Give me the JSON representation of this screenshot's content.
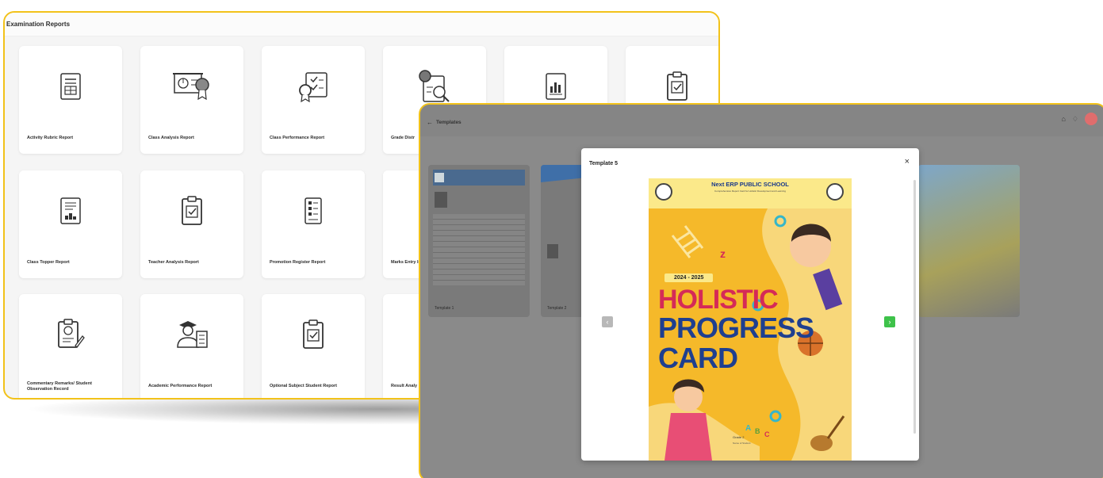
{
  "back_window": {
    "title": "Examination Reports",
    "reports": [
      {
        "label": "Activity Rubric Report",
        "icon": "report-sheet-icon"
      },
      {
        "label": "Class Analysis Report",
        "icon": "presentation-award-icon"
      },
      {
        "label": "Class Performance Report",
        "icon": "checklist-award-icon"
      },
      {
        "label": "Grade Distr",
        "icon": "document-search-icon"
      },
      {
        "label": "",
        "icon": "bar-chart-doc-icon"
      },
      {
        "label": "",
        "icon": "clipboard-check-icon"
      },
      {
        "label": "Class Topper Report",
        "icon": "ranking-doc-icon"
      },
      {
        "label": "Teacher Analysis Report",
        "icon": "clipboard-check-icon"
      },
      {
        "label": "Promotion Register Report",
        "icon": "list-doc-icon"
      },
      {
        "label": "Marks Entry Indicator R",
        "icon": "marks-entry-icon"
      },
      {
        "label": "Commentary Remarks/ Student Observation Record",
        "icon": "clipboard-pen-icon"
      },
      {
        "label": "Academic Performance Report",
        "icon": "graduate-doc-icon"
      },
      {
        "label": "Optional Subject Student Report",
        "icon": "clipboard-check-icon"
      },
      {
        "label": "Result Analy",
        "icon": "result-doc-icon"
      }
    ]
  },
  "front_window": {
    "back_label": "←",
    "title": "Templates",
    "header_icons": [
      "store-icon",
      "bell-icon",
      "avatar"
    ],
    "thumbnails": [
      {
        "label": "Template 1"
      },
      {
        "label": "Template 2"
      }
    ]
  },
  "modal": {
    "title": "Template 5",
    "close": "×",
    "prev": "‹",
    "next": "›",
    "poster": {
      "school": "Next ERP PUBLIC SCHOOL",
      "school_sub": "Comprehensive Report Card for Holistic Development and Learning",
      "session": "2024 - 2025",
      "line1": "HOLISTIC",
      "line2": "PROGRESS",
      "line3": "CARD",
      "class_line": "Grade 2",
      "class_sub": "Name of Student"
    }
  },
  "colors": {
    "frame_border": "#f2c21a",
    "next_button": "#3ec24a",
    "holistic_red": "#d52a57",
    "progress_blue": "#1f3f8f",
    "poster_yellow": "#f5b92a"
  }
}
